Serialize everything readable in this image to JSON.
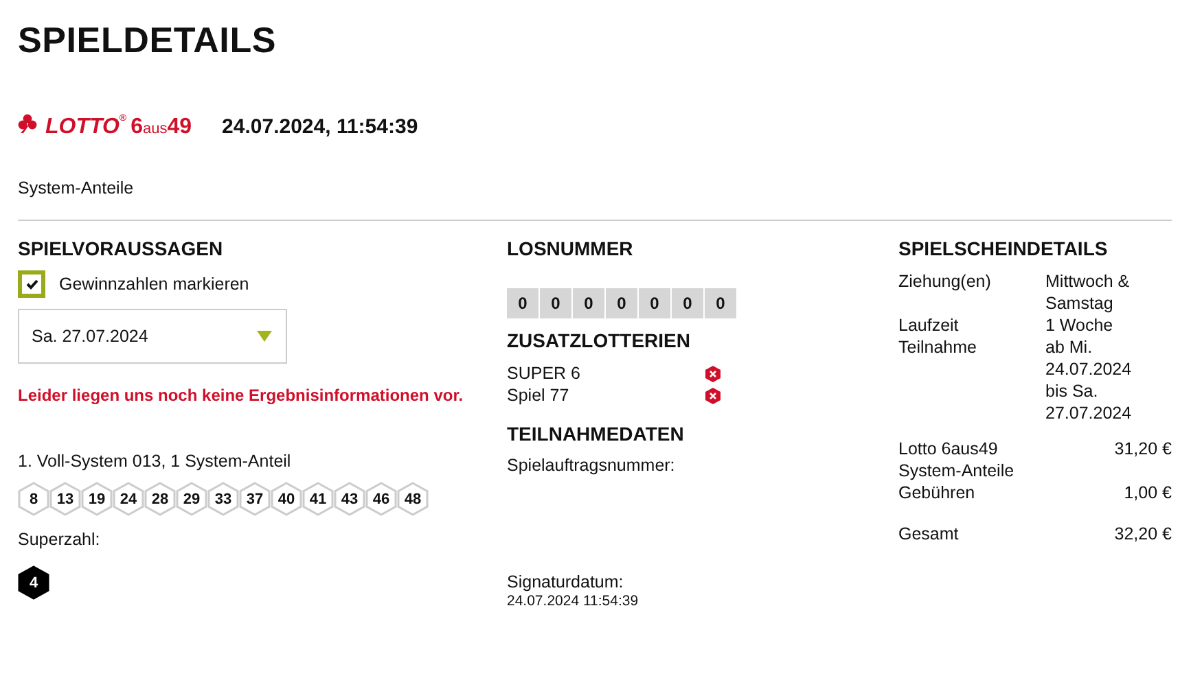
{
  "page": {
    "title": "SPIELDETAILS"
  },
  "header": {
    "logo_brand": "LOTTO",
    "logo_mark": "®",
    "logo_game": [
      "6",
      "aus",
      "49"
    ],
    "timestamp": "24.07.2024, 11:54:39",
    "subtitle": "System-Anteile"
  },
  "predictions": {
    "heading": "SPIELVORAUSSAGEN",
    "highlight": {
      "label": "Gewinnzahlen markieren",
      "checked": true
    },
    "draw_select": {
      "value": "Sa. 27.07.2024"
    },
    "notice": "Leider liegen uns noch keine Ergebnisinformationen vor.",
    "systems": [
      {
        "label": "1. Voll-System 013, 1 System-Anteil",
        "numbers": [
          "8",
          "13",
          "19",
          "24",
          "28",
          "29",
          "33",
          "37",
          "40",
          "41",
          "43",
          "46",
          "48"
        ]
      }
    ],
    "superzahl_label": "Superzahl:",
    "superzahl": "4"
  },
  "ticket": {
    "heading": "LOSNUMMER",
    "digits": [
      "0",
      "0",
      "0",
      "0",
      "0",
      "0",
      "0"
    ],
    "extras_heading": "ZUSATZLOTTERIEN",
    "extras": [
      {
        "name": "SUPER 6",
        "active": false
      },
      {
        "name": "Spiel 77",
        "active": false
      }
    ],
    "participation_heading": "TEILNAHMEDATEN",
    "order_label": "Spielauftragsnummer:",
    "signature_label": "Signaturdatum:",
    "signature_date": "24.07.2024 11:54:39"
  },
  "details": {
    "heading": "SPIELSCHEINDETAILS",
    "info": [
      {
        "label": "Ziehung(en)",
        "value": "Mittwoch & Samstag"
      },
      {
        "label": "Laufzeit",
        "value": "1 Woche"
      },
      {
        "label": "Teilnahme",
        "value": "ab Mi. 24.07.2024 bis Sa. 27.07.2024"
      }
    ],
    "costs": [
      {
        "label": "Lotto 6aus49 System-Anteile",
        "amount": "31,20 €"
      },
      {
        "label": "Gebühren",
        "amount": "1,00 €"
      }
    ],
    "total": {
      "label": "Gesamt",
      "amount": "32,20 €"
    }
  }
}
